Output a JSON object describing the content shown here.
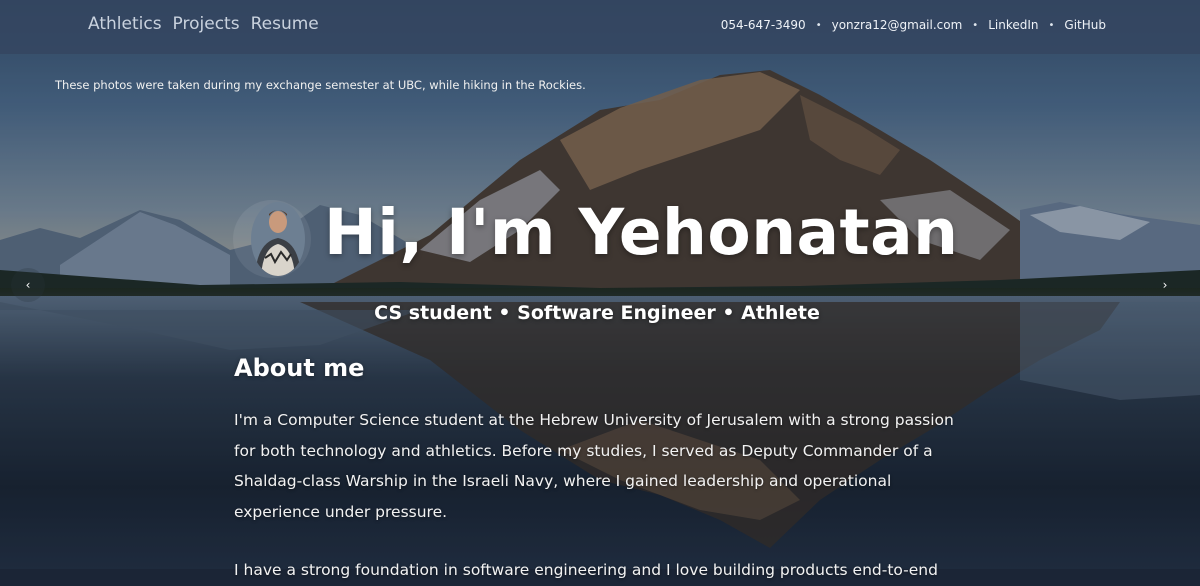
{
  "nav": {
    "links": [
      {
        "label": "Athletics"
      },
      {
        "label": "Projects"
      },
      {
        "label": "Resume"
      }
    ],
    "contact": {
      "phone": "054-647-3490",
      "email": "yonzra12@gmail.com",
      "linkedin": "LinkedIn",
      "github": "GitHub",
      "separator": "•"
    }
  },
  "carousel": {
    "caption": "These photos were taken during my exchange semester at UBC, while hiking in the Rockies.",
    "prev_label": "‹",
    "next_label": "›"
  },
  "hero": {
    "title": "Hi, I'm Yehonatan",
    "subtitle": "CS student • Software Engineer • Athlete"
  },
  "about": {
    "heading": "About me",
    "paragraph_1": "I'm a Computer Science student at the Hebrew University of Jerusalem with a strong passion for both technology and athletics. Before my studies, I served as Deputy Commander of a Shaldag-class Warship in the Israeli Navy, where I gained leadership and operational experience under pressure.",
    "paragraph_2": "I have a strong foundation in software engineering and I love building products end-to-end"
  },
  "colors": {
    "topbar": "#344660",
    "nav_link": "#c9d2de",
    "text": "#ffffff"
  }
}
